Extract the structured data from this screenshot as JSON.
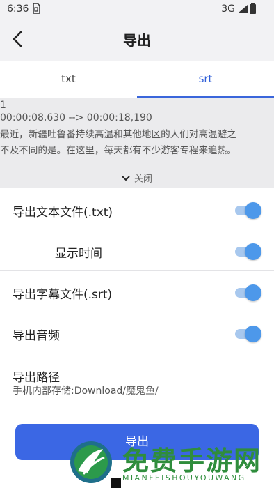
{
  "status_bar": {
    "time": "6:36",
    "sim_icon": "sim-card-icon",
    "network": "3G",
    "signal_icon": "signal-icon",
    "battery_icon": "battery-icon"
  },
  "header": {
    "title": "导出",
    "back_icon": "back-arrow-icon"
  },
  "tabs": [
    {
      "label": "txt",
      "selected": false
    },
    {
      "label": "srt",
      "selected": true
    }
  ],
  "preview": {
    "lines": [
      "1",
      "00:00:08,630 --> 00:00:18,190",
      "最近，新疆吐鲁番持续高温和其他地区的人们对高温避之",
      "不及不同的是。在这里，每天都有不少游客专程来追热。"
    ],
    "collapse_label": "关闭"
  },
  "settings": {
    "export_txt": {
      "label": "导出文本文件(.txt)",
      "enabled": true
    },
    "show_time": {
      "label": "显示时间",
      "enabled": true
    },
    "export_srt": {
      "label": "导出字幕文件(.srt)",
      "enabled": true
    },
    "export_audio": {
      "label": "导出音频",
      "enabled": true
    },
    "export_path": {
      "label": "导出路径",
      "value": "手机内部存储:Download/魔鬼鱼/"
    }
  },
  "export_button": {
    "label": "导出"
  },
  "watermark": {
    "text": "免费手游网",
    "subtext": "MIANFEISHOUYOUWANG"
  },
  "colors": {
    "accent": "#3b67e4",
    "toggle_on": "#4d98ea",
    "watermark": "#2f8d3c"
  }
}
